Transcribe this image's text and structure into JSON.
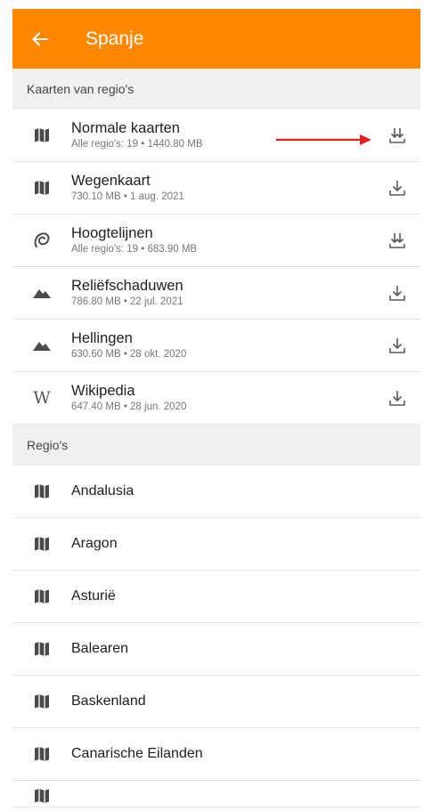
{
  "colors": {
    "accent": "#ff8800",
    "annotation": "#e0201c",
    "icon": "#4a4a4a"
  },
  "header": {
    "title": "Spanje",
    "back_icon": "arrow-left-icon"
  },
  "sections": {
    "maps_title": "Kaarten van regio's",
    "regions_title": "Regio's"
  },
  "map_downloads": [
    {
      "title": "Normale kaarten",
      "subtitle": "Alle regio's: 19 • 1440.80 MB",
      "icon": "map-icon",
      "action": "download-multiple-icon"
    },
    {
      "title": "Wegenkaart",
      "subtitle": "730.10 MB • 1 aug. 2021",
      "icon": "map-icon",
      "action": "download-icon"
    },
    {
      "title": "Hoogtelijnen",
      "subtitle": "Alle regio's: 19 • 683.90 MB",
      "icon": "contour-lines-icon",
      "action": "download-multiple-icon"
    },
    {
      "title": "Reliëfschaduwen",
      "subtitle": "786.80 MB • 22 jul. 2021",
      "icon": "mountains-icon",
      "action": "download-icon"
    },
    {
      "title": "Hellingen",
      "subtitle": "630.60 MB • 28 okt. 2020",
      "icon": "mountains-icon",
      "action": "download-icon"
    },
    {
      "title": "Wikipedia",
      "subtitle": "647.40 MB • 28 jun. 2020",
      "icon": "wikipedia-icon",
      "icon_glyph": "W",
      "action": "download-icon"
    }
  ],
  "regions": [
    {
      "name": "Andalusia",
      "icon": "map-icon"
    },
    {
      "name": "Aragon",
      "icon": "map-icon"
    },
    {
      "name": "Asturië",
      "icon": "map-icon"
    },
    {
      "name": "Balearen",
      "icon": "map-icon"
    },
    {
      "name": "Baskenland",
      "icon": "map-icon"
    },
    {
      "name": "Canarische Eilanden",
      "icon": "map-icon"
    }
  ]
}
